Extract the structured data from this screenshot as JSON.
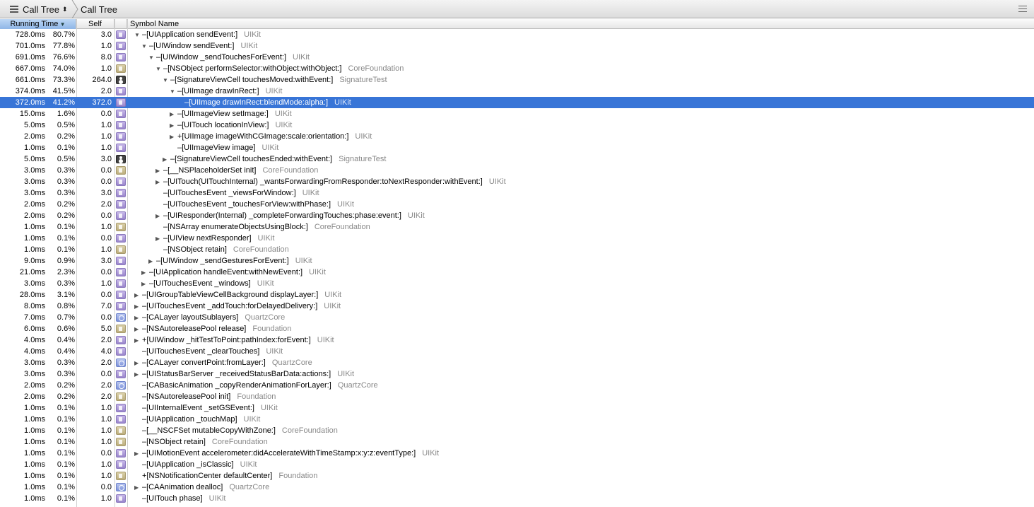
{
  "nav": {
    "first": "Call Tree",
    "second": "Call Tree"
  },
  "columns": {
    "running_time": "Running Time",
    "self": "Self",
    "symbol": "Symbol Name"
  },
  "rows": [
    {
      "time": "728.0ms",
      "pct": "80.7%",
      "self": "3.0",
      "icon": "p",
      "tri": "▼",
      "sym": "–[UIApplication sendEvent:]",
      "lib": "UIKit",
      "indent": 0
    },
    {
      "time": "701.0ms",
      "pct": "77.8%",
      "self": "1.0",
      "icon": "p",
      "tri": "▼",
      "sym": "–[UIWindow sendEvent:]",
      "lib": "UIKit",
      "indent": 1
    },
    {
      "time": "691.0ms",
      "pct": "76.6%",
      "self": "8.0",
      "icon": "p",
      "tri": "▼",
      "sym": "–[UIWindow _sendTouchesForEvent:]",
      "lib": "UIKit",
      "indent": 2
    },
    {
      "time": "667.0ms",
      "pct": "74.0%",
      "self": "1.0",
      "icon": "b",
      "tri": "▼",
      "sym": "–[NSObject performSelector:withObject:withObject:]",
      "lib": "CoreFoundation",
      "indent": 3
    },
    {
      "time": "661.0ms",
      "pct": "73.3%",
      "self": "264.0",
      "icon": "u",
      "tri": "▼",
      "sym": "–[SignatureViewCell touchesMoved:withEvent:]",
      "lib": "SignatureTest",
      "indent": 4
    },
    {
      "time": "374.0ms",
      "pct": "41.5%",
      "self": "2.0",
      "icon": "p",
      "tri": "▼",
      "sym": "–[UIImage drawInRect:]",
      "lib": "UIKit",
      "indent": 5
    },
    {
      "time": "372.0ms",
      "pct": "41.2%",
      "self": "372.0",
      "icon": "p",
      "tri": "",
      "sym": "–[UIImage drawInRect:blendMode:alpha:]",
      "lib": "UIKit",
      "indent": 6,
      "sel": true
    },
    {
      "time": "15.0ms",
      "pct": "1.6%",
      "self": "0.0",
      "icon": "p",
      "tri": "▶",
      "sym": "–[UIImageView setImage:]",
      "lib": "UIKit",
      "indent": 5
    },
    {
      "time": "5.0ms",
      "pct": "0.5%",
      "self": "1.0",
      "icon": "p",
      "tri": "▶",
      "sym": "–[UITouch locationInView:]",
      "lib": "UIKit",
      "indent": 5
    },
    {
      "time": "2.0ms",
      "pct": "0.2%",
      "self": "1.0",
      "icon": "p",
      "tri": "▶",
      "sym": "+[UIImage imageWithCGImage:scale:orientation:]",
      "lib": "UIKit",
      "indent": 5
    },
    {
      "time": "1.0ms",
      "pct": "0.1%",
      "self": "1.0",
      "icon": "p",
      "tri": "",
      "sym": "–[UIImageView image]",
      "lib": "UIKit",
      "indent": 5
    },
    {
      "time": "5.0ms",
      "pct": "0.5%",
      "self": "3.0",
      "icon": "u",
      "tri": "▶",
      "sym": "–[SignatureViewCell touchesEnded:withEvent:]",
      "lib": "SignatureTest",
      "indent": 4
    },
    {
      "time": "3.0ms",
      "pct": "0.3%",
      "self": "0.0",
      "icon": "b",
      "tri": "▶",
      "sym": "–[__NSPlaceholderSet init]",
      "lib": "CoreFoundation",
      "indent": 3
    },
    {
      "time": "3.0ms",
      "pct": "0.3%",
      "self": "0.0",
      "icon": "p",
      "tri": "▶",
      "sym": "–[UITouch(UITouchInternal) _wantsForwardingFromResponder:toNextResponder:withEvent:]",
      "lib": "UIKit",
      "indent": 3
    },
    {
      "time": "3.0ms",
      "pct": "0.3%",
      "self": "3.0",
      "icon": "p",
      "tri": "",
      "sym": "–[UITouchesEvent _viewsForWindow:]",
      "lib": "UIKit",
      "indent": 3
    },
    {
      "time": "2.0ms",
      "pct": "0.2%",
      "self": "2.0",
      "icon": "p",
      "tri": "",
      "sym": "–[UITouchesEvent _touchesForView:withPhase:]",
      "lib": "UIKit",
      "indent": 3
    },
    {
      "time": "2.0ms",
      "pct": "0.2%",
      "self": "0.0",
      "icon": "p",
      "tri": "▶",
      "sym": "–[UIResponder(Internal) _completeForwardingTouches:phase:event:]",
      "lib": "UIKit",
      "indent": 3
    },
    {
      "time": "1.0ms",
      "pct": "0.1%",
      "self": "1.0",
      "icon": "b",
      "tri": "",
      "sym": "–[NSArray enumerateObjectsUsingBlock:]",
      "lib": "CoreFoundation",
      "indent": 3
    },
    {
      "time": "1.0ms",
      "pct": "0.1%",
      "self": "0.0",
      "icon": "p",
      "tri": "▶",
      "sym": "–[UIView nextResponder]",
      "lib": "UIKit",
      "indent": 3
    },
    {
      "time": "1.0ms",
      "pct": "0.1%",
      "self": "1.0",
      "icon": "b",
      "tri": "",
      "sym": "–[NSObject retain]",
      "lib": "CoreFoundation",
      "indent": 3
    },
    {
      "time": "9.0ms",
      "pct": "0.9%",
      "self": "3.0",
      "icon": "p",
      "tri": "▶",
      "sym": "–[UIWindow _sendGesturesForEvent:]",
      "lib": "UIKit",
      "indent": 2
    },
    {
      "time": "21.0ms",
      "pct": "2.3%",
      "self": "0.0",
      "icon": "p",
      "tri": "▶",
      "sym": "–[UIApplication handleEvent:withNewEvent:]",
      "lib": "UIKit",
      "indent": 1
    },
    {
      "time": "3.0ms",
      "pct": "0.3%",
      "self": "1.0",
      "icon": "p",
      "tri": "▶",
      "sym": "–[UITouchesEvent _windows]",
      "lib": "UIKit",
      "indent": 1
    },
    {
      "time": "28.0ms",
      "pct": "3.1%",
      "self": "0.0",
      "icon": "p",
      "tri": "▶",
      "sym": "–[UIGroupTableViewCellBackground displayLayer:]",
      "lib": "UIKit",
      "indent": 0
    },
    {
      "time": "8.0ms",
      "pct": "0.8%",
      "self": "7.0",
      "icon": "p",
      "tri": "▶",
      "sym": "–[UITouchesEvent _addTouch:forDelayedDelivery:]",
      "lib": "UIKit",
      "indent": 0
    },
    {
      "time": "7.0ms",
      "pct": "0.7%",
      "self": "0.0",
      "icon": "q",
      "tri": "▶",
      "sym": "–[CALayer layoutSublayers]",
      "lib": "QuartzCore",
      "indent": 0
    },
    {
      "time": "6.0ms",
      "pct": "0.6%",
      "self": "5.0",
      "icon": "b",
      "tri": "▶",
      "sym": "–[NSAutoreleasePool release]",
      "lib": "Foundation",
      "indent": 0
    },
    {
      "time": "4.0ms",
      "pct": "0.4%",
      "self": "2.0",
      "icon": "p",
      "tri": "▶",
      "sym": "+[UIWindow _hitTestToPoint:pathIndex:forEvent:]",
      "lib": "UIKit",
      "indent": 0
    },
    {
      "time": "4.0ms",
      "pct": "0.4%",
      "self": "4.0",
      "icon": "p",
      "tri": "",
      "sym": "–[UITouchesEvent _clearTouches]",
      "lib": "UIKit",
      "indent": 0
    },
    {
      "time": "3.0ms",
      "pct": "0.3%",
      "self": "2.0",
      "icon": "q",
      "tri": "▶",
      "sym": "–[CALayer convertPoint:fromLayer:]",
      "lib": "QuartzCore",
      "indent": 0
    },
    {
      "time": "3.0ms",
      "pct": "0.3%",
      "self": "0.0",
      "icon": "p",
      "tri": "▶",
      "sym": "–[UIStatusBarServer _receivedStatusBarData:actions:]",
      "lib": "UIKit",
      "indent": 0
    },
    {
      "time": "2.0ms",
      "pct": "0.2%",
      "self": "2.0",
      "icon": "q",
      "tri": "",
      "sym": "–[CABasicAnimation _copyRenderAnimationForLayer:]",
      "lib": "QuartzCore",
      "indent": 0
    },
    {
      "time": "2.0ms",
      "pct": "0.2%",
      "self": "2.0",
      "icon": "b",
      "tri": "",
      "sym": "–[NSAutoreleasePool init]",
      "lib": "Foundation",
      "indent": 0
    },
    {
      "time": "1.0ms",
      "pct": "0.1%",
      "self": "1.0",
      "icon": "p",
      "tri": "",
      "sym": "–[UIInternalEvent _setGSEvent:]",
      "lib": "UIKit",
      "indent": 0
    },
    {
      "time": "1.0ms",
      "pct": "0.1%",
      "self": "1.0",
      "icon": "p",
      "tri": "",
      "sym": "–[UIApplication _touchMap]",
      "lib": "UIKit",
      "indent": 0
    },
    {
      "time": "1.0ms",
      "pct": "0.1%",
      "self": "1.0",
      "icon": "b",
      "tri": "",
      "sym": "–[__NSCFSet mutableCopyWithZone:]",
      "lib": "CoreFoundation",
      "indent": 0
    },
    {
      "time": "1.0ms",
      "pct": "0.1%",
      "self": "1.0",
      "icon": "b",
      "tri": "",
      "sym": "–[NSObject retain]",
      "lib": "CoreFoundation",
      "indent": 0
    },
    {
      "time": "1.0ms",
      "pct": "0.1%",
      "self": "0.0",
      "icon": "p",
      "tri": "▶",
      "sym": "–[UIMotionEvent accelerometer:didAccelerateWithTimeStamp:x:y:z:eventType:]",
      "lib": "UIKit",
      "indent": 0
    },
    {
      "time": "1.0ms",
      "pct": "0.1%",
      "self": "1.0",
      "icon": "p",
      "tri": "",
      "sym": "–[UIApplication _isClassic]",
      "lib": "UIKit",
      "indent": 0
    },
    {
      "time": "1.0ms",
      "pct": "0.1%",
      "self": "1.0",
      "icon": "b",
      "tri": "",
      "sym": "+[NSNotificationCenter defaultCenter]",
      "lib": "Foundation",
      "indent": 0
    },
    {
      "time": "1.0ms",
      "pct": "0.1%",
      "self": "0.0",
      "icon": "q",
      "tri": "▶",
      "sym": "–[CAAnimation dealloc]",
      "lib": "QuartzCore",
      "indent": 0
    },
    {
      "time": "1.0ms",
      "pct": "0.1%",
      "self": "1.0",
      "icon": "p",
      "tri": "",
      "sym": "–[UITouch phase]",
      "lib": "UIKit",
      "indent": 0
    }
  ]
}
